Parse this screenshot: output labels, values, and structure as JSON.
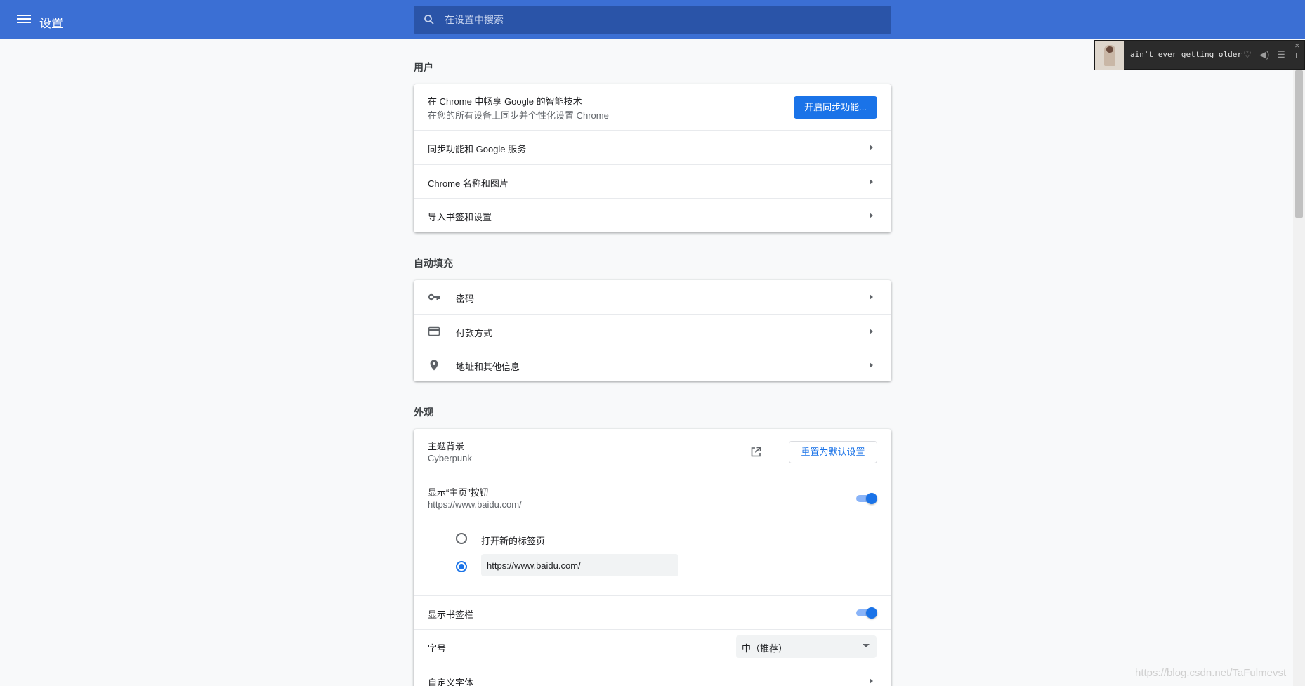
{
  "header": {
    "title": "设置",
    "search_placeholder": "在设置中搜索"
  },
  "player": {
    "song": "ain't ever getting older"
  },
  "sections": {
    "user": {
      "title": "用户",
      "sync_title": "在 Chrome 中畅享 Google 的智能技术",
      "sync_sub": "在您的所有设备上同步并个性化设置 Chrome",
      "sync_button": "开启同步功能...",
      "rows": [
        "同步功能和 Google 服务",
        "Chrome 名称和图片",
        "导入书签和设置"
      ]
    },
    "autofill": {
      "title": "自动填充",
      "rows": [
        {
          "label": "密码",
          "icon": "key-icon"
        },
        {
          "label": "付款方式",
          "icon": "credit-card-icon"
        },
        {
          "label": "地址和其他信息",
          "icon": "location-pin-icon"
        }
      ]
    },
    "appearance": {
      "title": "外观",
      "theme_label": "主题背景",
      "theme_value": "Cyberpunk",
      "reset_button": "重置为默认设置",
      "home_label": "显示“主页”按钮",
      "home_value": "https://www.baidu.com/",
      "home_enabled": true,
      "radio_new_tab": "打开新的标签页",
      "custom_url": "https://www.baidu.com/",
      "selected_option": "custom_url",
      "bookmarks_label": "显示书签栏",
      "bookmarks_enabled": true,
      "font_size_label": "字号",
      "font_size_value": "中（推荐）",
      "custom_fonts_label": "自定义字体"
    }
  },
  "watermark": "https://blog.csdn.net/TaFulmevst",
  "colors": {
    "header": "#3b6fd4",
    "accent": "#1a73e8"
  }
}
